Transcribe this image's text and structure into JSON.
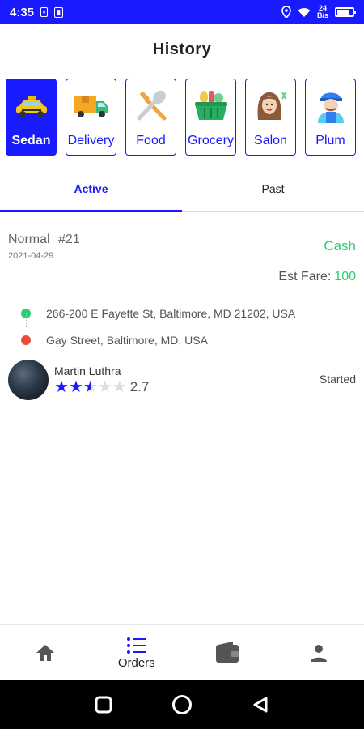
{
  "status_bar": {
    "time": "4:35",
    "network_speed_top": "24",
    "network_speed_bottom": "B/s"
  },
  "header": {
    "title": "History"
  },
  "categories": [
    {
      "label": "Sedan",
      "icon": "taxi-icon",
      "active": true
    },
    {
      "label": "Delivery",
      "icon": "truck-icon",
      "active": false
    },
    {
      "label": "Food",
      "icon": "utensils-icon",
      "active": false
    },
    {
      "label": "Grocery",
      "icon": "basket-icon",
      "active": false
    },
    {
      "label": "Salon",
      "icon": "salon-icon",
      "active": false
    },
    {
      "label": "Plum",
      "icon": "plumber-icon",
      "active": false
    }
  ],
  "tabs": [
    {
      "label": "Active",
      "active": true
    },
    {
      "label": "Past",
      "active": false
    }
  ],
  "order": {
    "type": "Normal",
    "number": "#21",
    "date": "2021-04-29",
    "payment": "Cash",
    "fare_label": "Est Fare:",
    "fare_value": "100",
    "pickup": "266-200 E Fayette St, Baltimore, MD 21202, USA",
    "dropoff": "Gay Street, Baltimore, MD, USA",
    "driver": {
      "name": "Martin Luthra",
      "rating": "2.7",
      "stars_filled": 2.5,
      "stars_total": 5
    },
    "status": "Started"
  },
  "bottom_nav": [
    {
      "label": "",
      "icon": "home-icon",
      "active": false
    },
    {
      "label": "Orders",
      "icon": "list-icon",
      "active": true
    },
    {
      "label": "",
      "icon": "wallet-icon",
      "active": false
    },
    {
      "label": "",
      "icon": "person-icon",
      "active": false
    }
  ],
  "colors": {
    "primary": "#1a1aff",
    "success": "#2ecc71",
    "danger": "#e74c3c"
  }
}
